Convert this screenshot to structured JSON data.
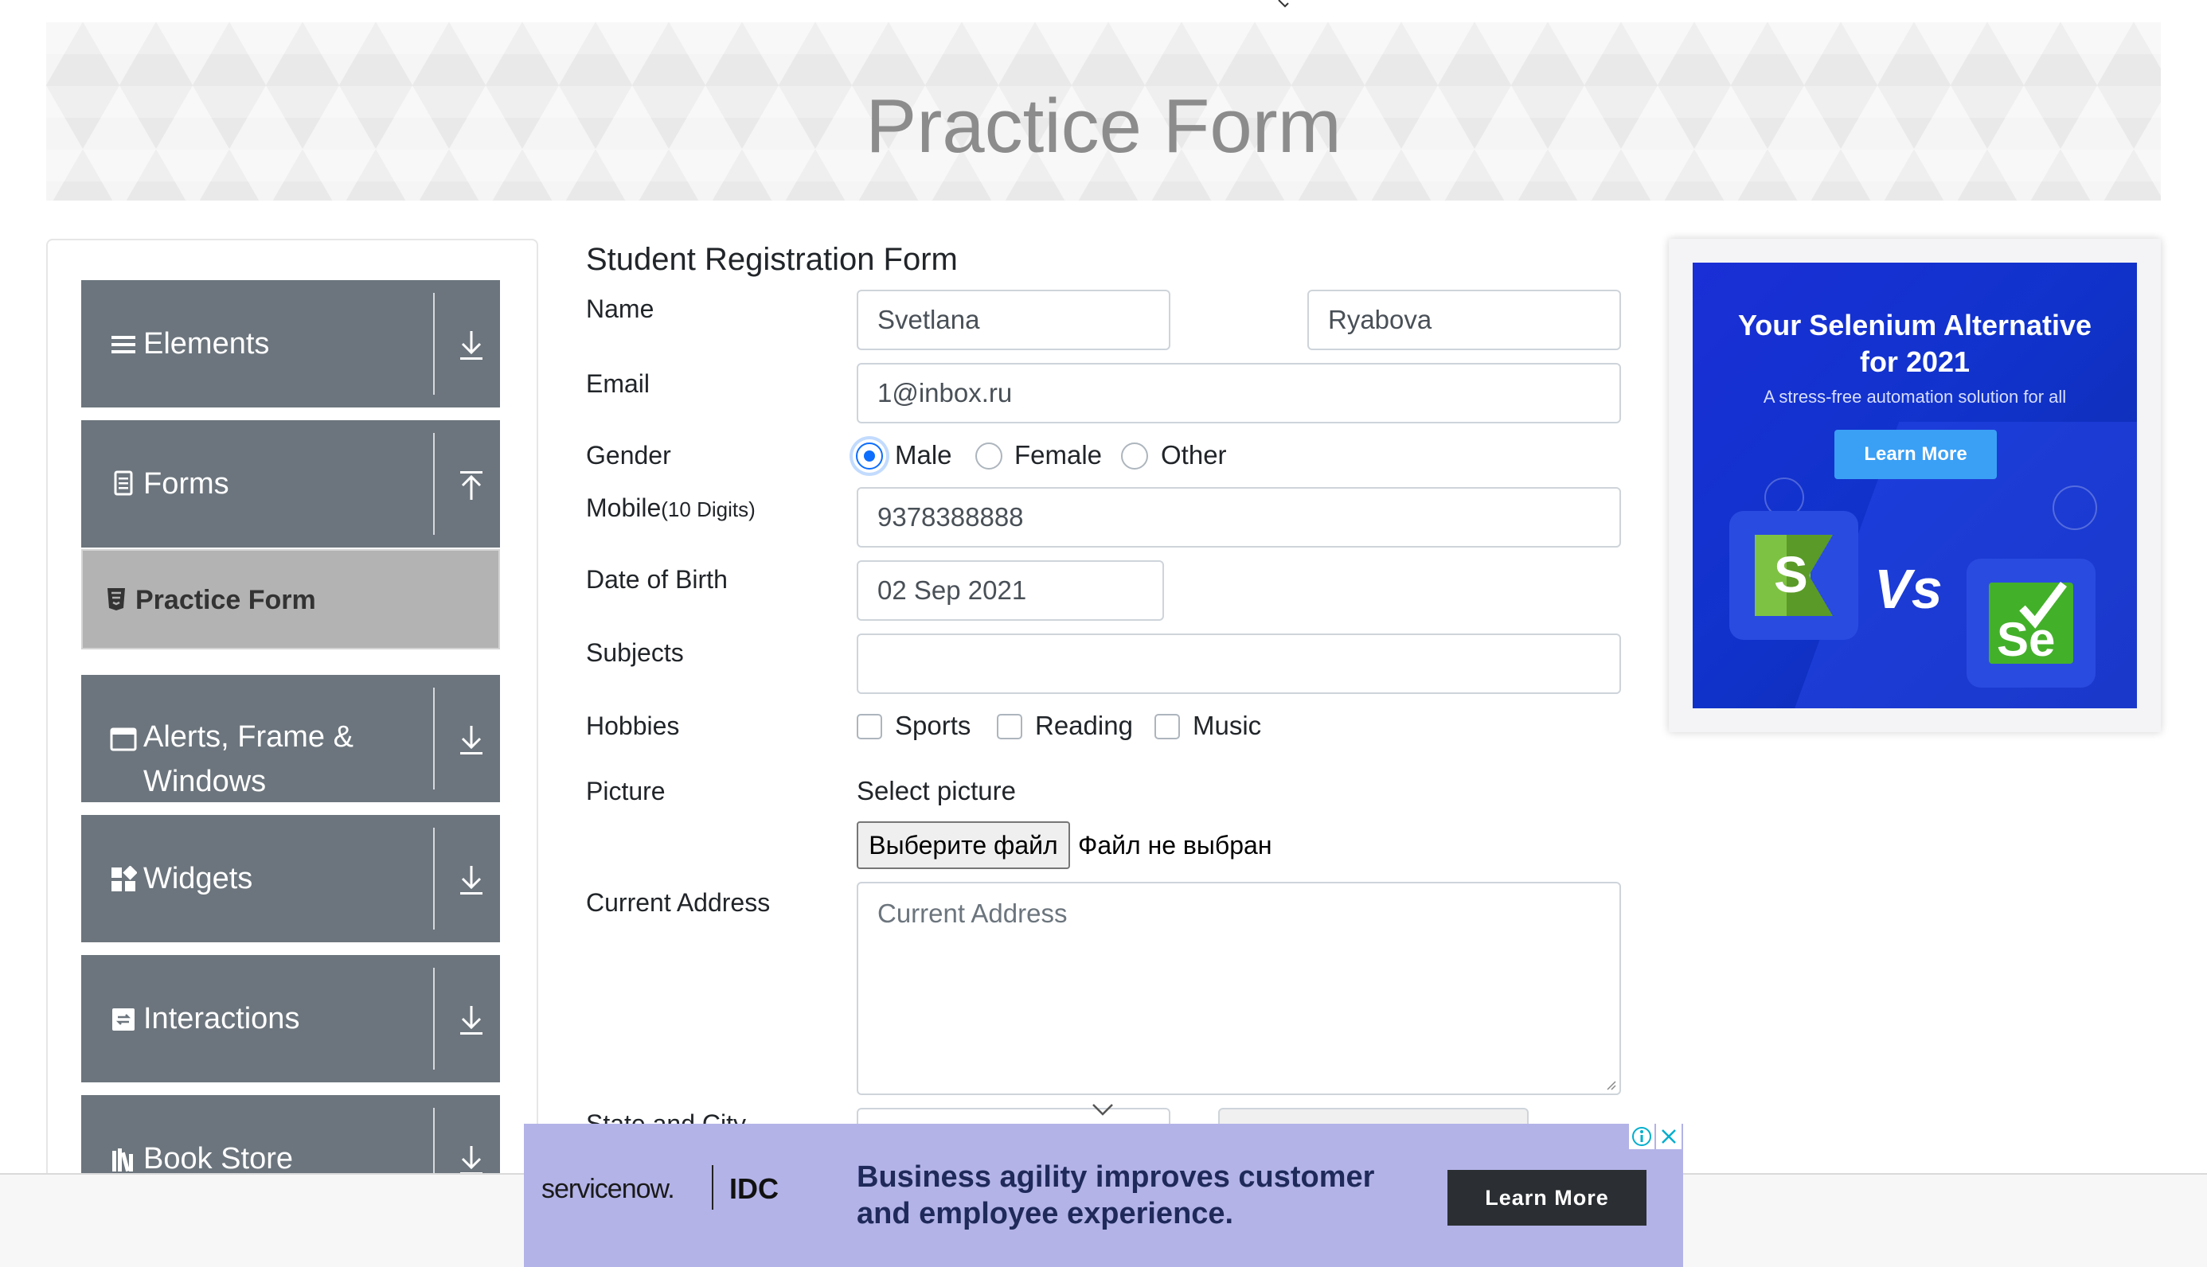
{
  "header": {
    "title": "Practice Form"
  },
  "sidebar": {
    "groups": [
      {
        "label": "Elements",
        "icon": "hamburger-icon",
        "arrow": "download-arrow-icon"
      },
      {
        "label": "Forms",
        "icon": "document-icon",
        "arrow": "upload-arrow-icon"
      },
      {
        "label": "Alerts, Frame &",
        "label2": "Windows",
        "icon": "window-icon",
        "arrow": "download-arrow-icon"
      },
      {
        "label": "Widgets",
        "icon": "widgets-icon",
        "arrow": "download-arrow-icon"
      },
      {
        "label": "Interactions",
        "icon": "interactions-icon",
        "arrow": "download-arrow-icon"
      },
      {
        "label": "Book Store",
        "icon": "books-icon",
        "arrow": "download-arrow-icon"
      }
    ],
    "active_item": {
      "label": "Practice Form",
      "icon": "html5-icon"
    }
  },
  "form": {
    "title": "Student Registration Form",
    "name": {
      "label": "Name",
      "first": "Svetlana",
      "last": "Ryabova"
    },
    "email": {
      "label": "Email",
      "value": "1@inbox.ru"
    },
    "gender": {
      "label": "Gender",
      "options": [
        "Male",
        "Female",
        "Other"
      ],
      "selected": "Male"
    },
    "mobile": {
      "label": "Mobile",
      "hint": "(10 Digits)",
      "value": "9378388888"
    },
    "dob": {
      "label": "Date of Birth",
      "value": "02 Sep 2021"
    },
    "subjects": {
      "label": "Subjects",
      "value": ""
    },
    "hobbies": {
      "label": "Hobbies",
      "options": [
        "Sports",
        "Reading",
        "Music"
      ]
    },
    "picture": {
      "label": "Picture",
      "select_text": "Select picture",
      "button": "Выберите файл",
      "status": "Файл не выбран"
    },
    "address": {
      "label": "Current Address",
      "placeholder": "Current Address"
    },
    "state_city": {
      "label": "State and City"
    }
  },
  "ad_right": {
    "title_line1": "Your Selenium Alternative",
    "title_line2": "for 2021",
    "subtitle": "A stress-free automation solution for all",
    "button": "Learn More",
    "vs": "Vs",
    "logo_left": "S",
    "logo_right": "Se"
  },
  "ad_bottom": {
    "brand": "servicenow.",
    "partner": "IDC",
    "headline": "Business agility improves customer and employee experience.",
    "button": "Learn More"
  },
  "colors": {
    "sidebar_group": "#6c757d",
    "active_item": "#b3b3b3",
    "radio_accent": "#0d6efd",
    "ad_right_bg": "#1a2fd6",
    "ad_bottom_bg": "#b3b3e8"
  }
}
